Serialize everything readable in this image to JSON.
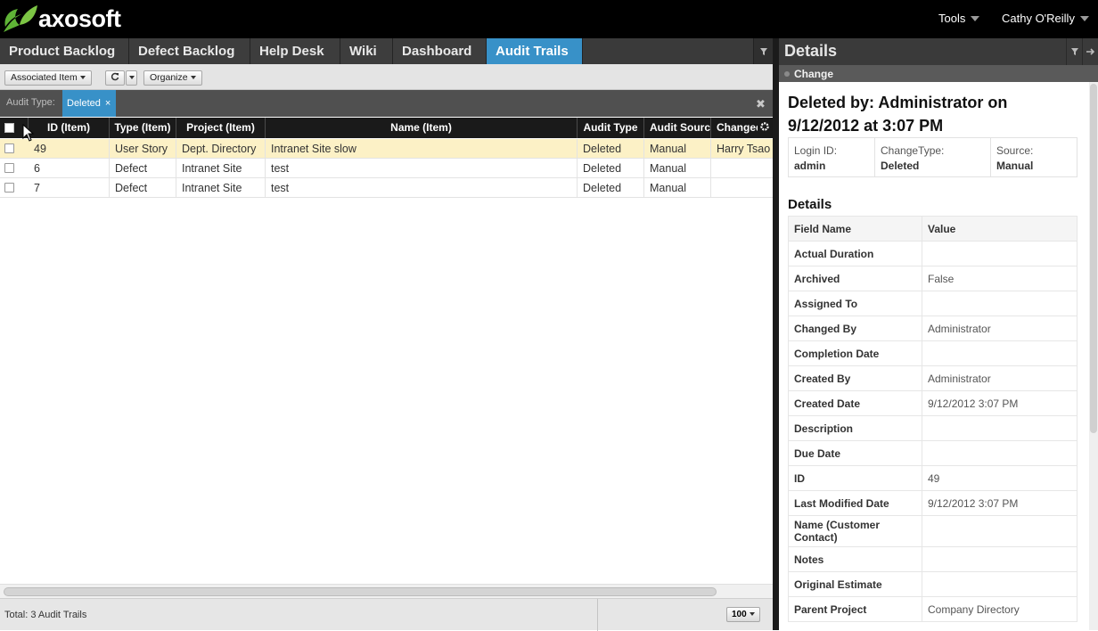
{
  "header": {
    "brand": "axosoft",
    "tools_label": "Tools",
    "user_label": "Cathy O'Reilly"
  },
  "tabs": [
    {
      "label": "Product Backlog"
    },
    {
      "label": "Defect Backlog"
    },
    {
      "label": "Help Desk"
    },
    {
      "label": "Wiki"
    },
    {
      "label": "Dashboard"
    },
    {
      "label": "Audit Trails",
      "active": true
    }
  ],
  "toolbar": {
    "associated_item": "Associated Item",
    "organize": "Organize"
  },
  "filter": {
    "label": "Audit Type:",
    "chip": "Deleted",
    "chip_close": "×",
    "clear": "✖"
  },
  "grid": {
    "columns": [
      "ID (Item)",
      "Type (Item)",
      "Project (Item)",
      "Name (Item)",
      "Audit Type",
      "Audit Source",
      "Changed By"
    ],
    "rows": [
      {
        "id": "49",
        "type": "User Story",
        "project": "Dept. Directory",
        "name": "Intranet Site slow",
        "audit_type": "Deleted",
        "audit_source": "Manual",
        "changed_by": "Harry Tsao"
      },
      {
        "id": "6",
        "type": "Defect",
        "project": "Intranet Site",
        "name": "test",
        "audit_type": "Deleted",
        "audit_source": "Manual",
        "changed_by": ""
      },
      {
        "id": "7",
        "type": "Defect",
        "project": "Intranet Site",
        "name": "test",
        "audit_type": "Deleted",
        "audit_source": "Manual",
        "changed_by": ""
      }
    ]
  },
  "status": {
    "total": "Total: 3 Audit Trails",
    "page_size": "100"
  },
  "details": {
    "title": "Details",
    "section": "Change",
    "change_title": "Deleted by: Administrator on 9/12/2012 at 3:07 PM",
    "login_label": "Login ID:",
    "login_value": "admin",
    "changetype_label": "ChangeType:",
    "changetype_value": "Deleted",
    "source_label": "Source:",
    "source_value": "Manual",
    "fields_heading": "Details",
    "col_field": "Field Name",
    "col_value": "Value",
    "fields": [
      {
        "name": "Actual Duration",
        "value": ""
      },
      {
        "name": "Archived",
        "value": "False"
      },
      {
        "name": "Assigned To",
        "value": ""
      },
      {
        "name": "Changed By",
        "value": "Administrator"
      },
      {
        "name": "Completion Date",
        "value": ""
      },
      {
        "name": "Created By",
        "value": "Administrator"
      },
      {
        "name": "Created Date",
        "value": "9/12/2012 3:07 PM"
      },
      {
        "name": "Description",
        "value": ""
      },
      {
        "name": "Due Date",
        "value": ""
      },
      {
        "name": "ID",
        "value": "49"
      },
      {
        "name": "Last Modified Date",
        "value": "9/12/2012 3:07 PM"
      },
      {
        "name": "Name (Customer Contact)",
        "value": "",
        "tall": true
      },
      {
        "name": "Notes",
        "value": ""
      },
      {
        "name": "Original Estimate",
        "value": ""
      },
      {
        "name": "Parent Project",
        "value": "Company Directory"
      }
    ]
  },
  "colors": {
    "accent": "#3891c8",
    "selected_row": "#fcf1c6",
    "logo_green": "#5fb336"
  }
}
